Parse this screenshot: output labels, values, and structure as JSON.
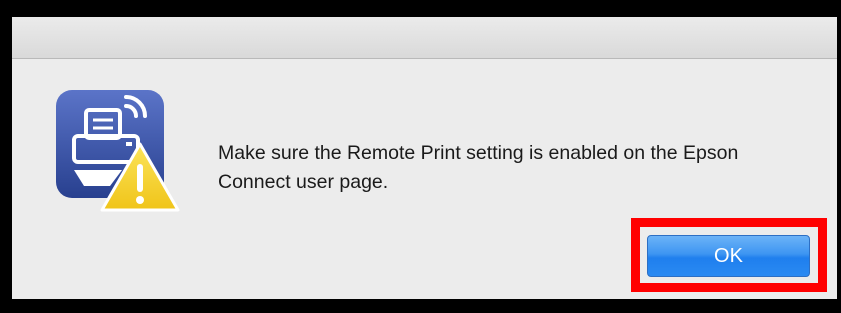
{
  "dialog": {
    "icon": "printer-warning-icon",
    "message": "Make sure the Remote Print setting is enabled on the Epson Connect user page.",
    "ok_label": "OK"
  },
  "colors": {
    "ok_button": "#2a8af2",
    "highlight": "#ff0000",
    "icon_background": "#3e56a8",
    "warning": "#f5d32b"
  }
}
